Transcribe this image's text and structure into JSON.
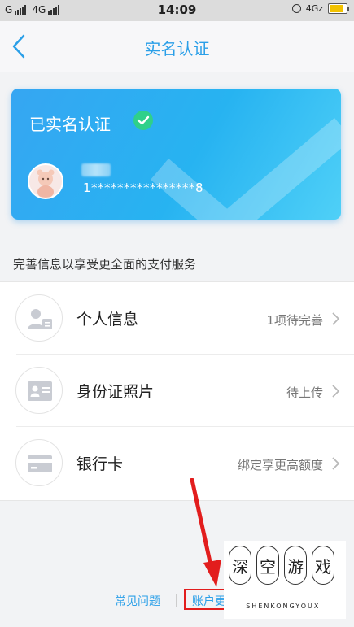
{
  "status_bar": {
    "carrier1": "G",
    "carrier2": "4G",
    "time": "14:09",
    "network_right": "4Gz",
    "icons": [
      "signal-icon",
      "alarm-icon",
      "battery-icon"
    ],
    "battery_level": 0.8
  },
  "nav": {
    "title": "实名认证",
    "back_icon": "chevron-left-icon"
  },
  "card": {
    "title": "已实名认证",
    "verified_icon": "check-circle-icon",
    "id_number": "1****************8"
  },
  "section": {
    "label": "完善信息以享受更全面的支付服务"
  },
  "items": [
    {
      "label": "个人信息",
      "status": "1项待完善",
      "icon": "person-card-icon"
    },
    {
      "label": "身份证照片",
      "status": "待上传",
      "icon": "id-card-icon"
    },
    {
      "label": "银行卡",
      "status": "绑定享更高额度",
      "icon": "bank-card-icon"
    }
  ],
  "footer": {
    "faq": "常见问题",
    "account": "账户更"
  },
  "colors": {
    "accent": "#2a9fe8",
    "card_start": "#36a6f2",
    "card_end": "#4fd0f7",
    "verified": "#2fd08a",
    "annotation": "#e21d1d"
  },
  "watermark": {
    "chars": [
      "深",
      "空",
      "游",
      "戏"
    ],
    "sub": "SHENKONGYOUXI"
  }
}
